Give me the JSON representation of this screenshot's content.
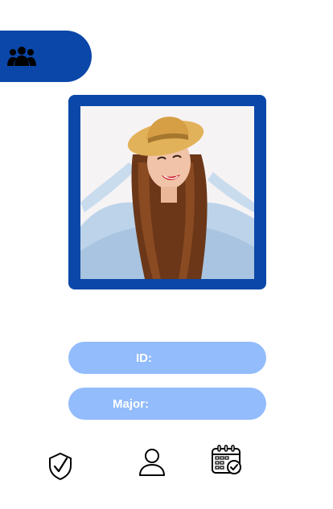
{
  "app": {
    "header_icon": "group-icon"
  },
  "profile": {
    "photo_description_icon": "profile-photo"
  },
  "fields": {
    "id_label": "ID:",
    "major_label": "Major:"
  },
  "nav": {
    "items": [
      {
        "icon": "shield-check-icon"
      },
      {
        "icon": "user-icon"
      },
      {
        "icon": "calendar-check-icon"
      }
    ]
  },
  "colors": {
    "primary": "#0a47a8",
    "field": "#92bcfc",
    "field_text": "#ffffff"
  }
}
